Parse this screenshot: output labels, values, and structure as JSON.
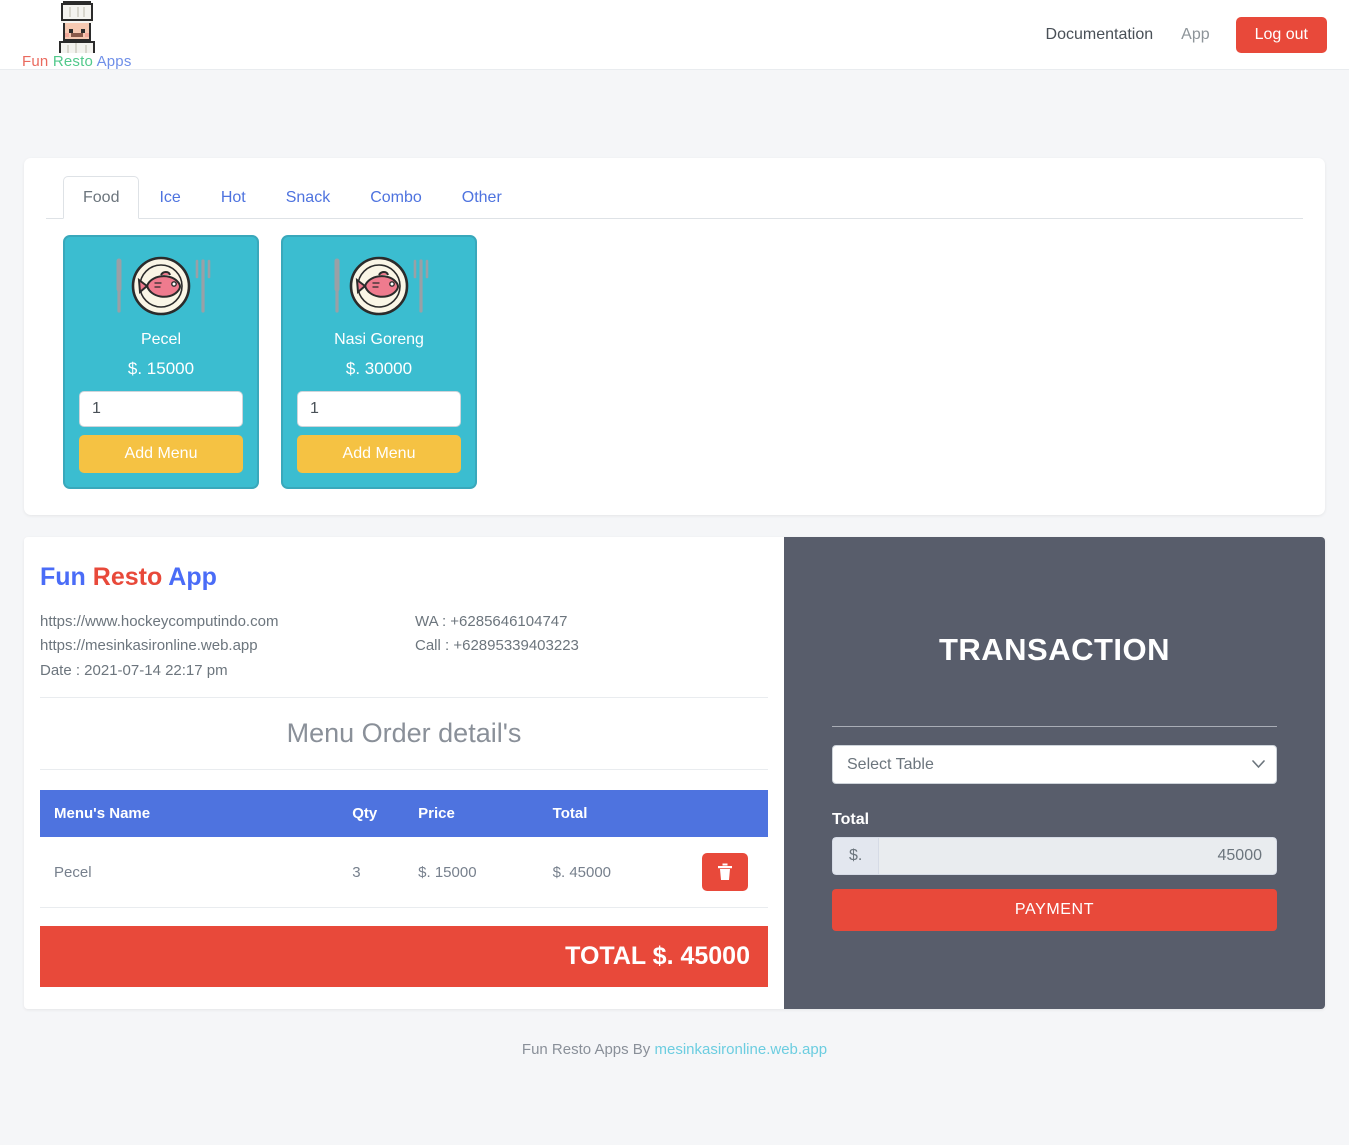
{
  "navbar": {
    "brand": {
      "word1": "Fun",
      "word2": "Resto",
      "word3": "Apps",
      "logo_icon": "chef-avatar-icon"
    },
    "links": [
      {
        "label": "Documentation",
        "name": "nav-link-documentation"
      },
      {
        "label": "App",
        "name": "nav-link-app"
      }
    ],
    "logout_label": "Log out"
  },
  "menu_panel": {
    "tabs": [
      {
        "label": "Food",
        "active": true
      },
      {
        "label": "Ice",
        "active": false
      },
      {
        "label": "Hot",
        "active": false
      },
      {
        "label": "Snack",
        "active": false
      },
      {
        "label": "Combo",
        "active": false
      },
      {
        "label": "Other",
        "active": false
      }
    ],
    "items": [
      {
        "name": "Pecel",
        "price": "$. 15000",
        "qty": "1",
        "add_label": "Add Menu",
        "icon": "fish-plate-icon"
      },
      {
        "name": "Nasi Goreng",
        "price": "$. 30000",
        "qty": "1",
        "add_label": "Add Menu",
        "icon": "fish-plate-icon"
      }
    ]
  },
  "receipt": {
    "brand": {
      "word1": "Fun",
      "word2": "Resto",
      "word3": "App"
    },
    "website1": "https://www.hockeycomputindo.com",
    "website2": "https://mesinkasironline.web.app",
    "date": "Date : 2021-07-14 22:17 pm",
    "wa": "WA : +6285646104747",
    "call": "Call : +62895339403223",
    "order_title": "Menu Order detail's",
    "columns": [
      "Menu's Name",
      "Qty",
      "Price",
      "Total"
    ],
    "rows": [
      {
        "name": "Pecel",
        "qty": "3",
        "price": "$. 15000",
        "total": "$. 45000",
        "delete_icon": "trash-icon"
      }
    ],
    "grand_total": "TOTAL $. 45000"
  },
  "transaction": {
    "title": "TRANSACTION",
    "select_value": "Select Table",
    "select_options": [
      "Select Table"
    ],
    "total_label": "Total",
    "currency_prefix": "$.",
    "total_value": "45000",
    "payment_label": "PAYMENT"
  },
  "footer": {
    "text": "Fun Resto Apps By ",
    "link": "mesinkasironline.web.app"
  },
  "colors": {
    "accent_red": "#e8493a",
    "tab_blue": "#4e73df",
    "menu_teal": "#3bbdd0",
    "add_yellow": "#f5c243",
    "panel_dark": "#585d6b"
  }
}
